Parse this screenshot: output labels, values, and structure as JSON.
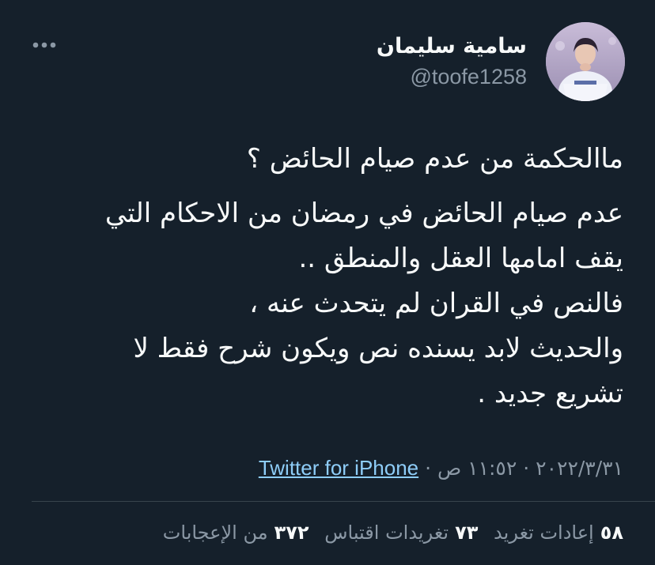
{
  "author": {
    "name": "سامية سليمان",
    "handle": "@toofe1258"
  },
  "tweet": {
    "title_line": "ماالحكمة من عدم صيام الحائض ؟",
    "body_lines": [
      "عدم صيام الحائض في رمضان من الاحكام التي",
      "يقف امامها العقل والمنطق ..",
      "فالنص في القران لم يتحدث عنه ،",
      "والحديث لابد يسنده نص ويكون شرح فقط لا",
      "تشريع جديد ."
    ]
  },
  "meta": {
    "date": "٢٠٢٢/٣/٣١",
    "separator": "·",
    "time": "١١:٥٢ ص",
    "source": "Twitter for iPhone"
  },
  "stats": {
    "retweets_count": "٥٨",
    "retweets_label": "إعادات تغريد",
    "quotes_count": "٧٣",
    "quotes_label": "تغريدات اقتباس",
    "likes_count": "٣٧٢",
    "likes_label": "من الإعجابات"
  },
  "icons": {
    "more": "more-horizontal-icon"
  },
  "colors": {
    "background": "#15202b",
    "text_primary": "#f7f9f9",
    "text_secondary": "#8b98a5",
    "link": "#8ecdf8",
    "divider": "#38444d"
  }
}
